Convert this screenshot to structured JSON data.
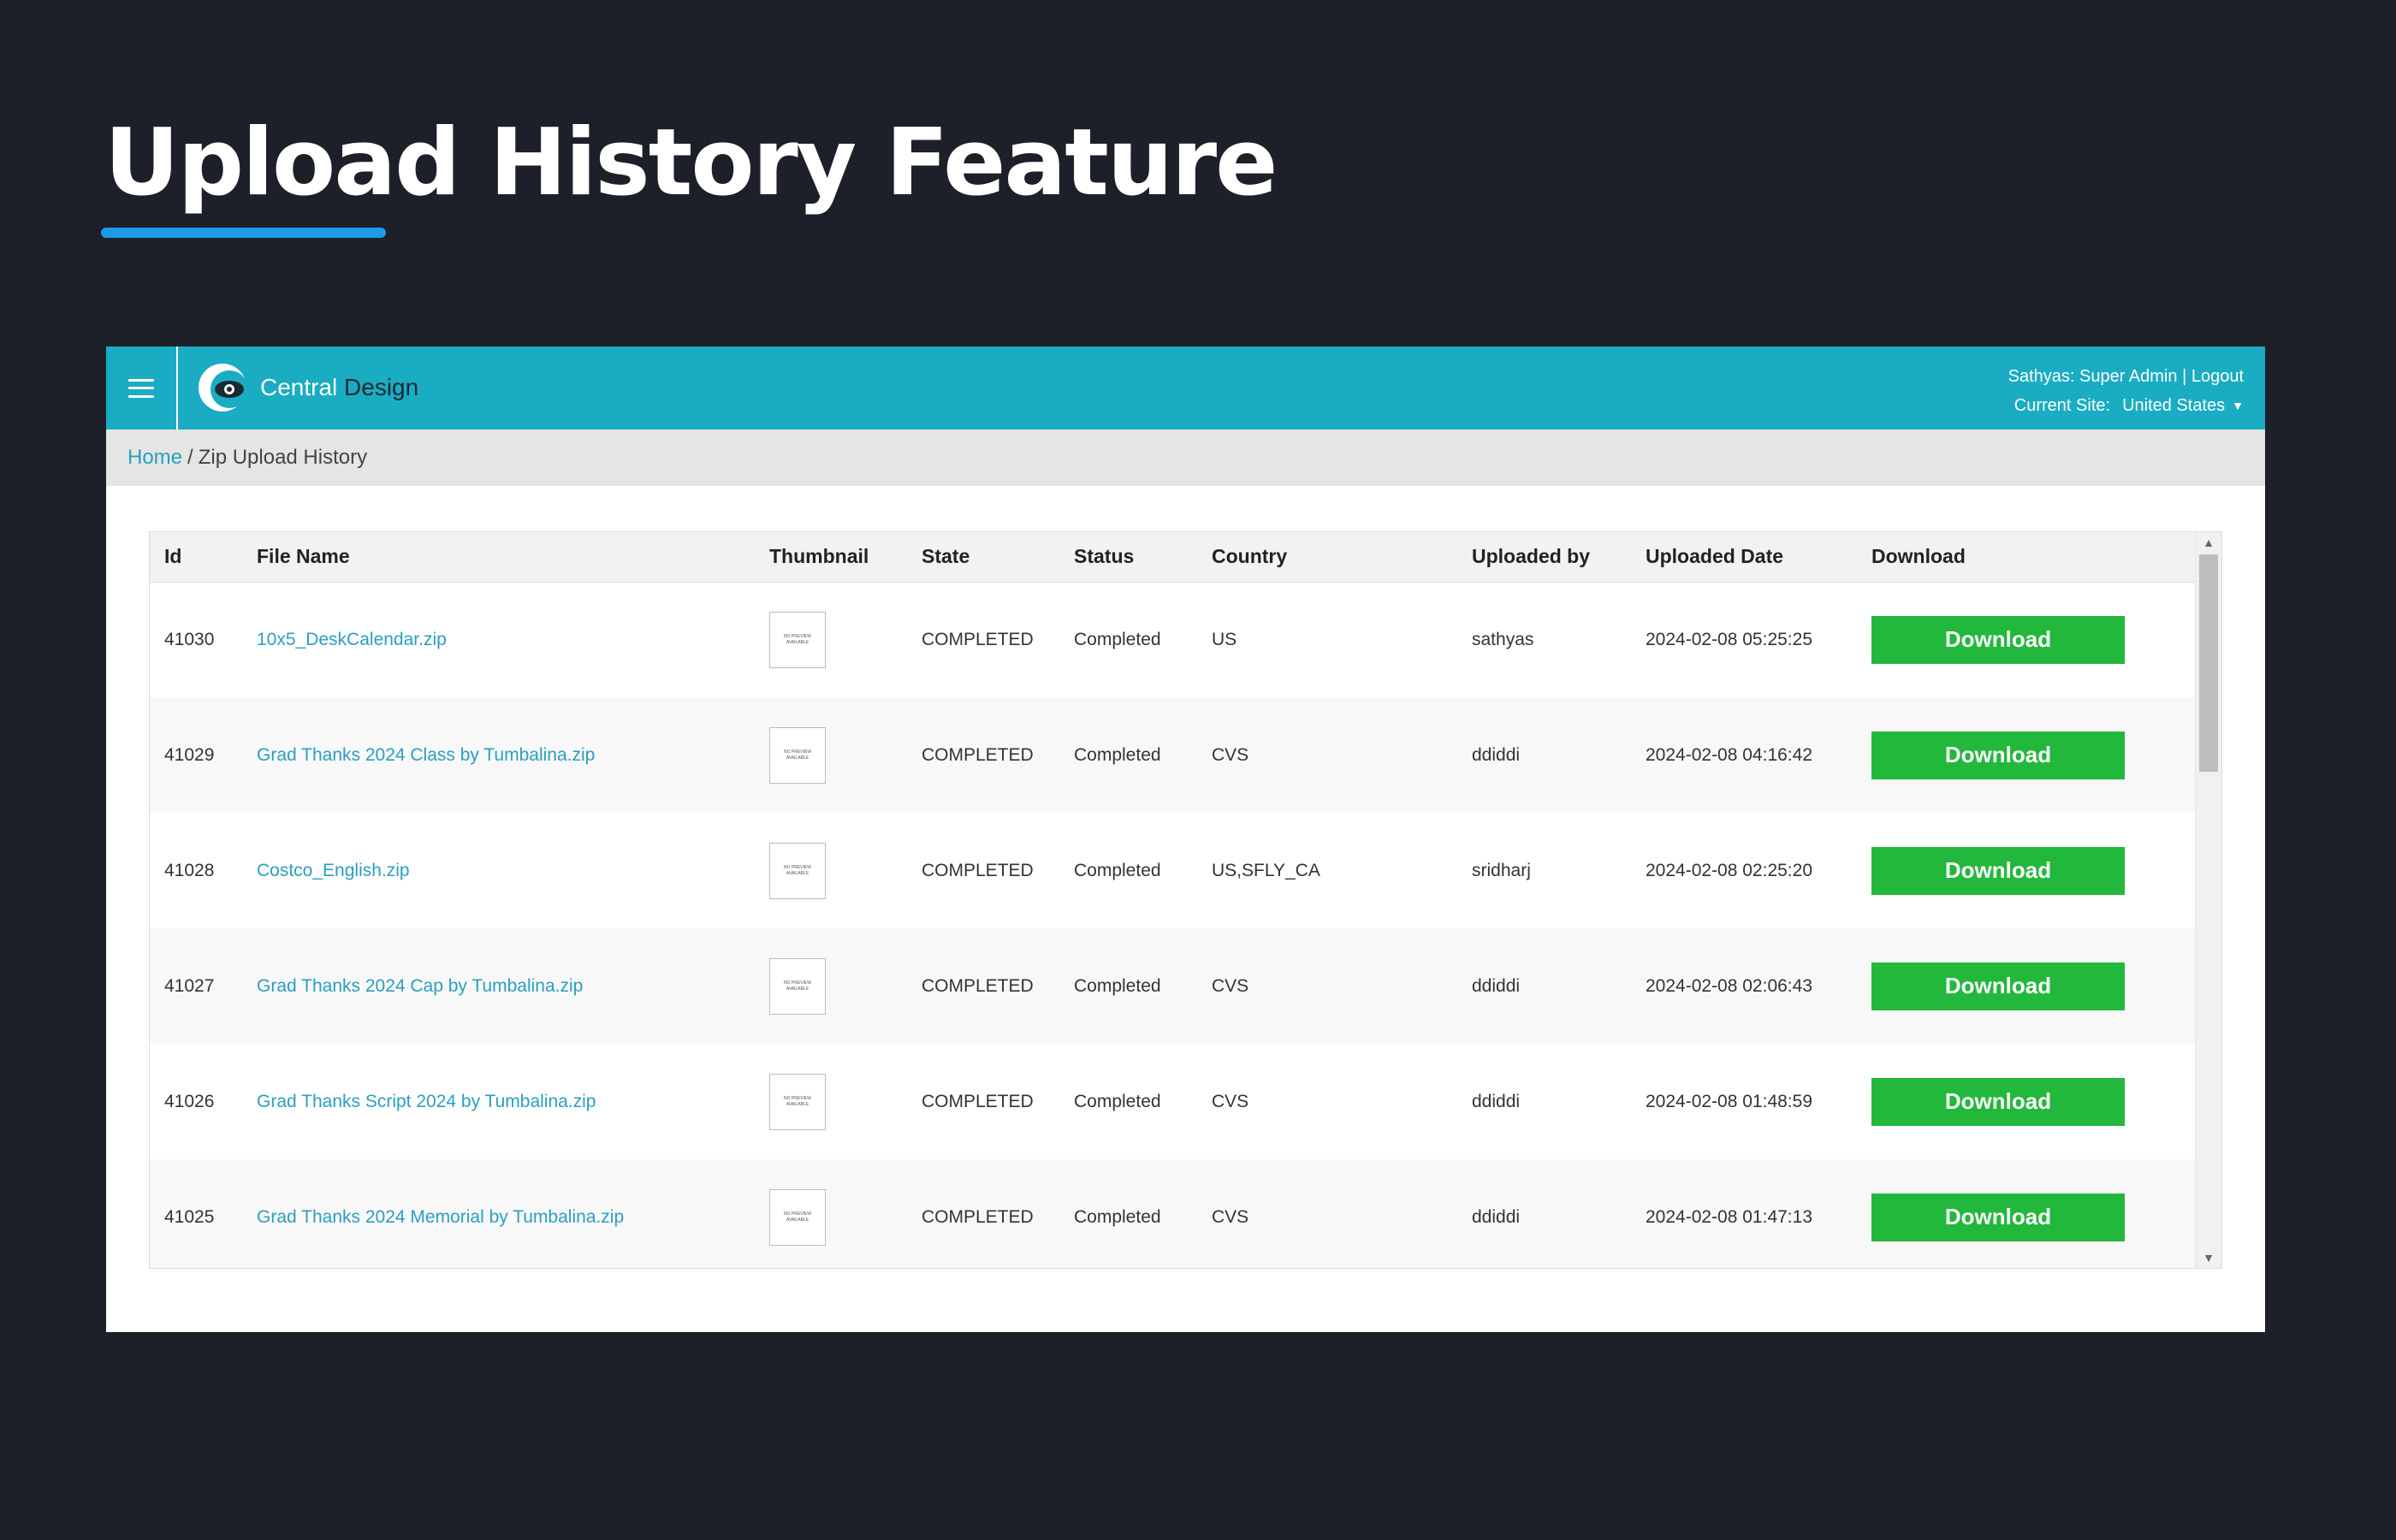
{
  "slide": {
    "title": "Upload History Feature"
  },
  "header": {
    "brand_word1": "Central",
    "brand_word2": "Design",
    "user_label": "Sathyas: Super Admin",
    "separator": "|",
    "logout_label": "Logout",
    "site_label": "Current Site:",
    "site_value": "United States"
  },
  "breadcrumb": {
    "home": "Home",
    "separator": "/",
    "current": "Zip Upload History"
  },
  "table": {
    "columns": [
      "Id",
      "File Name",
      "Thumbnail",
      "State",
      "Status",
      "Country",
      "Uploaded by",
      "Uploaded Date",
      "Download"
    ],
    "thumbnail_text": [
      "NO PREVIEW",
      "AVAILABLE"
    ],
    "download_label": "Download",
    "rows": [
      {
        "id": "41030",
        "file": "10x5_DeskCalendar.zip",
        "state": "COMPLETED",
        "status": "Completed",
        "country": "US",
        "by": "sathyas",
        "date": "2024-02-08 05:25:25"
      },
      {
        "id": "41029",
        "file": "Grad Thanks 2024 Class by Tumbalina.zip",
        "state": "COMPLETED",
        "status": "Completed",
        "country": "CVS",
        "by": "ddiddi",
        "date": "2024-02-08 04:16:42"
      },
      {
        "id": "41028",
        "file": "Costco_English.zip",
        "state": "COMPLETED",
        "status": "Completed",
        "country": "US,SFLY_CA",
        "by": "sridharj",
        "date": "2024-02-08 02:25:20"
      },
      {
        "id": "41027",
        "file": "Grad Thanks 2024 Cap by Tumbalina.zip",
        "state": "COMPLETED",
        "status": "Completed",
        "country": "CVS",
        "by": "ddiddi",
        "date": "2024-02-08 02:06:43"
      },
      {
        "id": "41026",
        "file": "Grad Thanks Script 2024 by Tumbalina.zip",
        "state": "COMPLETED",
        "status": "Completed",
        "country": "CVS",
        "by": "ddiddi",
        "date": "2024-02-08 01:48:59"
      },
      {
        "id": "41025",
        "file": "Grad Thanks 2024 Memorial by Tumbalina.zip",
        "state": "COMPLETED",
        "status": "Completed",
        "country": "CVS",
        "by": "ddiddi",
        "date": "2024-02-08 01:47:13"
      }
    ]
  },
  "colors": {
    "header_bg": "#1aacc2",
    "download_bg": "#22b83c",
    "link": "#2a9fc0",
    "slide_bg": "#1d2029",
    "accent_underline": "#1e9ae6"
  },
  "icons": {
    "menu": "hamburger-icon",
    "logo": "eye-logo-icon",
    "caret": "caret-down-icon"
  }
}
